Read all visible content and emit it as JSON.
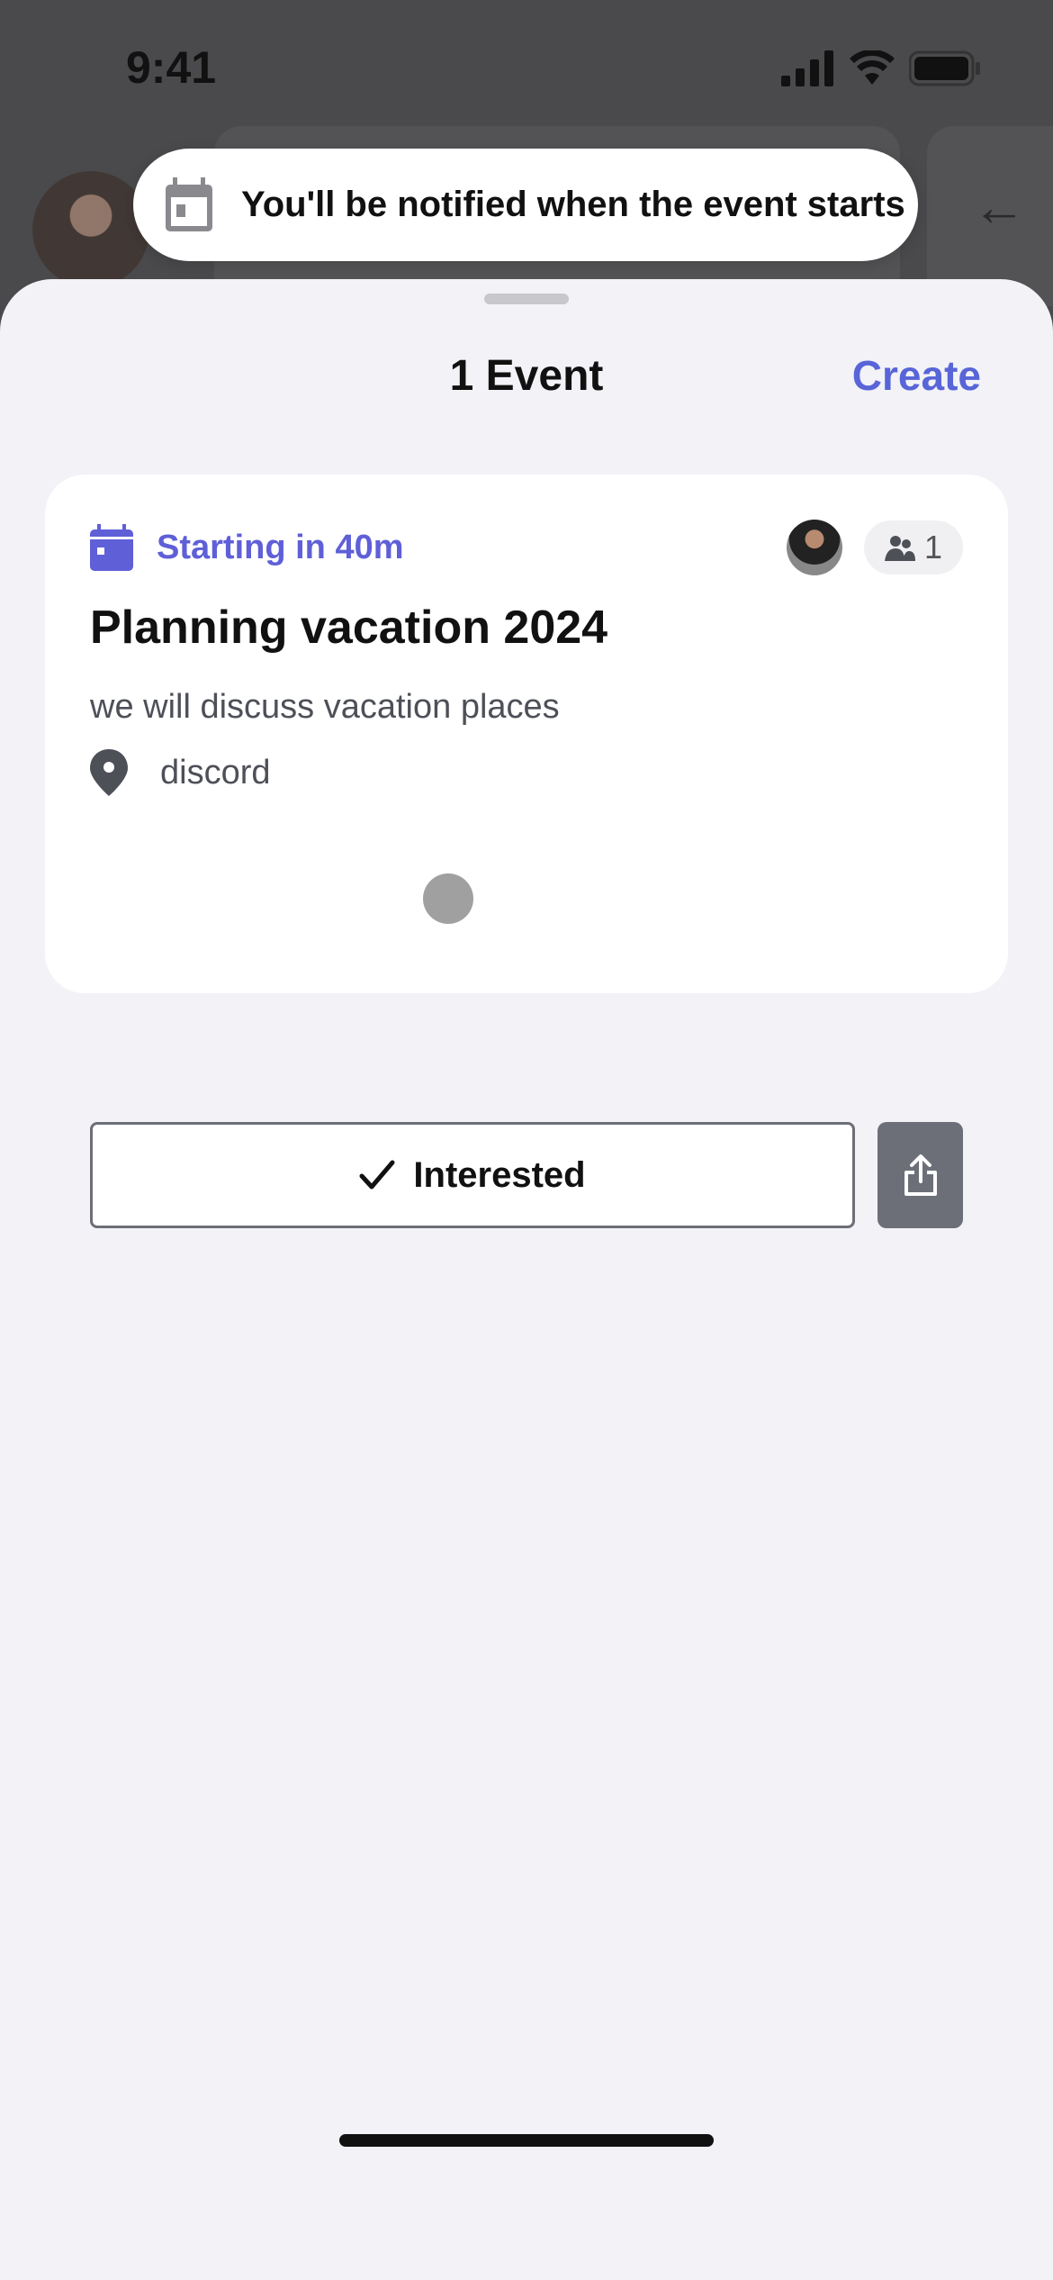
{
  "status_bar": {
    "time": "9:41",
    "icons": [
      "signal-icon",
      "wifi-icon",
      "battery-icon"
    ]
  },
  "toast": {
    "icon": "calendar-icon",
    "message": "You'll be notified when the event starts"
  },
  "sheet": {
    "title": "1 Event",
    "create_label": "Create",
    "accent_color": "#5865d8"
  },
  "event_card": {
    "status_icon": "calendar-icon",
    "status_text": "Starting in 40m",
    "attendee_count": "1",
    "title": "Planning vacation 2024",
    "description": "we will discuss vacation places",
    "location_icon": "location-pin-icon",
    "location": "discord",
    "interested_label": "Interested",
    "interested_checked": true,
    "share_icon": "share-icon"
  }
}
